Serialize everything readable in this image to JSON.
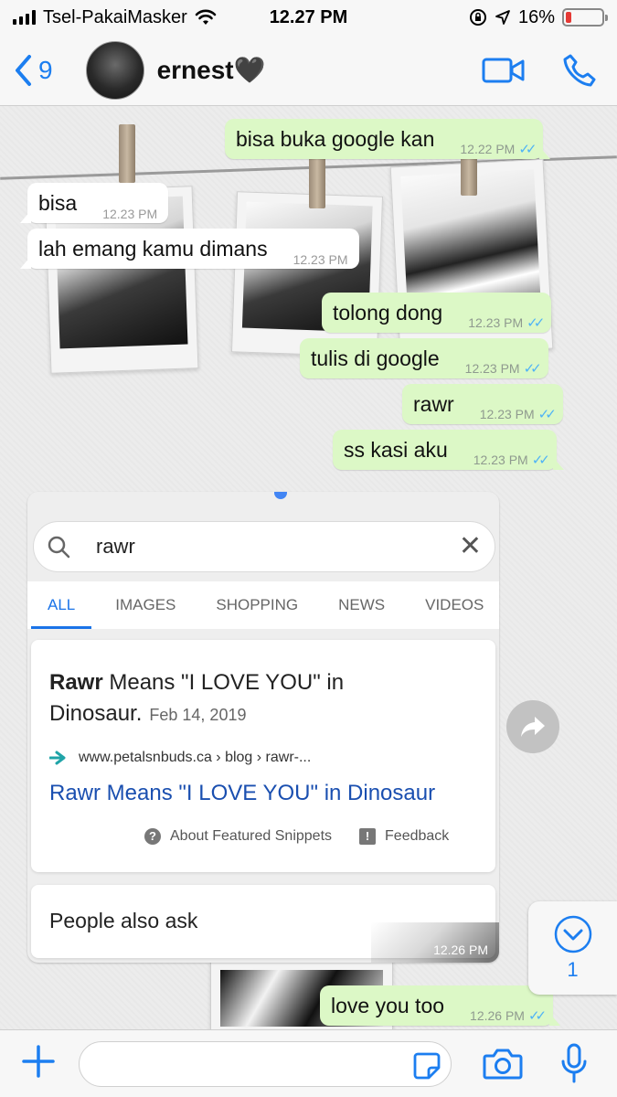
{
  "status_bar": {
    "carrier": "Tsel-PakaiMasker",
    "time": "12.27 PM",
    "battery": "16%",
    "battery_level": 0.16,
    "battery_color": "#e53935"
  },
  "header": {
    "back_count": "9",
    "contact_name": "ernest🖤",
    "accent": "#1c7ef0",
    "icons": [
      "chevron-left-icon",
      "video-call-icon",
      "phone-icon"
    ]
  },
  "messages": [
    {
      "dir": "out",
      "text": "bisa buka google kan",
      "time": "12.22 PM",
      "read": true
    },
    {
      "dir": "in",
      "text": "bisa",
      "time": "12.23 PM"
    },
    {
      "dir": "in",
      "text": "lah emang kamu dimans",
      "time": "12.23 PM"
    },
    {
      "dir": "out",
      "text": "tolong dong",
      "time": "12.23 PM",
      "read": true
    },
    {
      "dir": "out",
      "text": "tulis di google",
      "time": "12.23 PM",
      "read": true
    },
    {
      "dir": "out",
      "text": "rawr",
      "time": "12.23 PM",
      "read": true
    },
    {
      "dir": "out",
      "text": "ss kasi aku",
      "time": "12.23 PM",
      "read": true
    },
    {
      "dir": "out",
      "text": "love you too",
      "time": "12.26 PM",
      "read": true
    }
  ],
  "image_message": {
    "time": "12.26 PM",
    "search_query": "rawr",
    "tabs": [
      "ALL",
      "IMAGES",
      "SHOPPING",
      "NEWS",
      "VIDEOS"
    ],
    "active_tab": "ALL",
    "snippet": {
      "title_bold": "Rawr",
      "title_rest": " Means \"I LOVE YOU\" in Dinosaur.",
      "date": "Feb 14, 2019",
      "url": "www.petalsnbuds.ca › blog › rawr-...",
      "link": "Rawr Means \"I LOVE YOU\" in Dinosaur",
      "footer_about": "About Featured Snippets",
      "footer_feedback": "Feedback"
    },
    "people_also_ask": "People also ask"
  },
  "scroll_down": {
    "unread_count": "1"
  },
  "colors": {
    "outgoing_bubble": "#dcf8c6",
    "incoming_bubble": "#ffffff",
    "read_ticks": "#4fb3f6",
    "google_blue": "#1a73e8"
  }
}
